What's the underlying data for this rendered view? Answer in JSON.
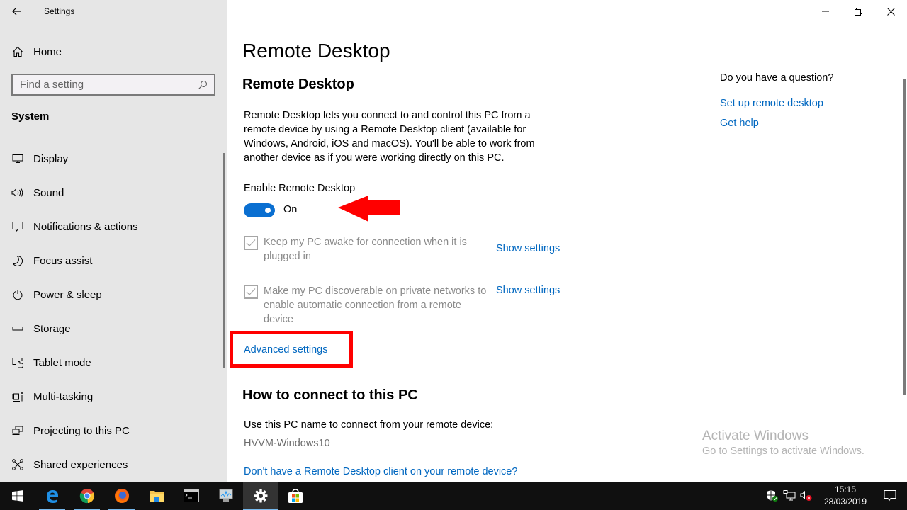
{
  "window": {
    "title": "Settings",
    "controls": {
      "minimize": "minimize",
      "maximize": "restore",
      "close": "close"
    }
  },
  "sidebar": {
    "home_label": "Home",
    "search_placeholder": "Find a setting",
    "section": "System",
    "items": [
      {
        "label": "Display",
        "icon": "monitor-icon"
      },
      {
        "label": "Sound",
        "icon": "speaker-icon"
      },
      {
        "label": "Notifications & actions",
        "icon": "message-icon"
      },
      {
        "label": "Focus assist",
        "icon": "moon-icon"
      },
      {
        "label": "Power & sleep",
        "icon": "power-icon"
      },
      {
        "label": "Storage",
        "icon": "drive-icon"
      },
      {
        "label": "Tablet mode",
        "icon": "tablet-icon"
      },
      {
        "label": "Multi-tasking",
        "icon": "multitask-icon"
      },
      {
        "label": "Projecting to this PC",
        "icon": "project-icon"
      },
      {
        "label": "Shared experiences",
        "icon": "share-icon"
      }
    ]
  },
  "main": {
    "page_title": "Remote Desktop",
    "section_title": "Remote Desktop",
    "description": "Remote Desktop lets you connect to and control this PC from a remote device by using a Remote Desktop client (available for Windows, Android, iOS and macOS). You'll be able to work from another device as if you were working directly on this PC.",
    "enable_label": "Enable Remote Desktop",
    "toggle": {
      "state": "On",
      "checked": true
    },
    "options": [
      {
        "label": "Keep my PC awake for connection when it is plugged in",
        "checked": true,
        "link": "Show settings"
      },
      {
        "label": "Make my PC discoverable on private networks to enable automatic connection from a remote device",
        "checked": true,
        "link": "Show settings"
      }
    ],
    "advanced_link": "Advanced settings",
    "connect_heading": "How to connect to this PC",
    "use_name_label": "Use this PC name to connect from your remote device:",
    "pc_name": "HVVM-Windows10",
    "client_link": "Don't have a Remote Desktop client on your remote device?"
  },
  "help": {
    "question": "Do you have a question?",
    "links": [
      "Set up remote desktop",
      "Get help"
    ]
  },
  "watermark": {
    "title": "Activate Windows",
    "subtitle": "Go to Settings to activate Windows."
  },
  "annotations": {
    "color": "#ff0000",
    "highlight_target": "Advanced settings",
    "arrow_target": "Enable Remote Desktop toggle"
  },
  "taskbar": {
    "apps": [
      {
        "name": "start",
        "icon": "windows-logo-icon"
      },
      {
        "name": "Microsoft Edge",
        "icon": "edge-icon",
        "running": true
      },
      {
        "name": "Google Chrome",
        "icon": "chrome-icon",
        "running": true
      },
      {
        "name": "Firefox",
        "icon": "firefox-icon",
        "running": true
      },
      {
        "name": "File Explorer",
        "icon": "folder-icon"
      },
      {
        "name": "Command Prompt",
        "icon": "cmd-icon"
      },
      {
        "name": "Performance Monitor",
        "icon": "perfmon-icon"
      },
      {
        "name": "Settings",
        "icon": "gear-icon",
        "active": true
      },
      {
        "name": "Microsoft Store",
        "icon": "store-icon"
      }
    ],
    "tray": {
      "time": "15:15",
      "date": "28/03/2019"
    }
  },
  "colors": {
    "accent": "#0a6fd1",
    "link": "#0067c0",
    "sidebar_bg": "#e6e6e6",
    "taskbar_bg": "#101010"
  }
}
